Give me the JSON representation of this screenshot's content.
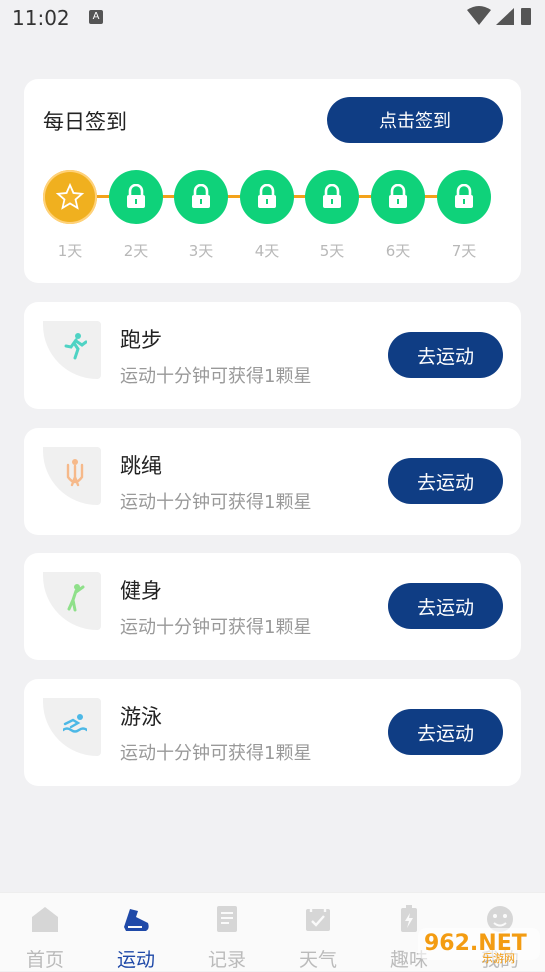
{
  "status_bar": {
    "time": "11:02",
    "notification": "A"
  },
  "checkin": {
    "title": "每日签到",
    "button_label": "点击签到",
    "days": [
      {
        "label": "1天",
        "state": "star"
      },
      {
        "label": "2天",
        "state": "locked"
      },
      {
        "label": "3天",
        "state": "locked"
      },
      {
        "label": "4天",
        "state": "locked"
      },
      {
        "label": "5天",
        "state": "locked"
      },
      {
        "label": "6天",
        "state": "locked"
      },
      {
        "label": "7天",
        "state": "locked"
      }
    ]
  },
  "sports": [
    {
      "name": "跑步",
      "desc": "运动十分钟可获得1颗星",
      "button": "去运动",
      "icon": "running-icon",
      "icon_color": "#4fd3c4"
    },
    {
      "name": "跳绳",
      "desc": "运动十分钟可获得1颗星",
      "button": "去运动",
      "icon": "jump-rope-icon",
      "icon_color": "#f6b98a"
    },
    {
      "name": "健身",
      "desc": "运动十分钟可获得1颗星",
      "button": "去运动",
      "icon": "fitness-icon",
      "icon_color": "#8fe08a"
    },
    {
      "name": "游泳",
      "desc": "运动十分钟可获得1颗星",
      "button": "去运动",
      "icon": "swimming-icon",
      "icon_color": "#4cb8e6"
    }
  ],
  "tabs": [
    {
      "label": "首页",
      "icon": "home-icon",
      "active": false
    },
    {
      "label": "运动",
      "icon": "shoe-icon",
      "active": true
    },
    {
      "label": "记录",
      "icon": "record-icon",
      "active": false
    },
    {
      "label": "天气",
      "icon": "calendar-icon",
      "active": false
    },
    {
      "label": "趣味",
      "icon": "battery-icon",
      "active": false
    },
    {
      "label": "我的",
      "icon": "face-icon",
      "active": false
    }
  ],
  "watermark": {
    "text": "962.NET",
    "subtext": "乐游网"
  },
  "colors": {
    "primary": "#0f3d84",
    "accent_green": "#0fd27a",
    "accent_orange": "#f3a21a",
    "star": "#f0b01f"
  }
}
